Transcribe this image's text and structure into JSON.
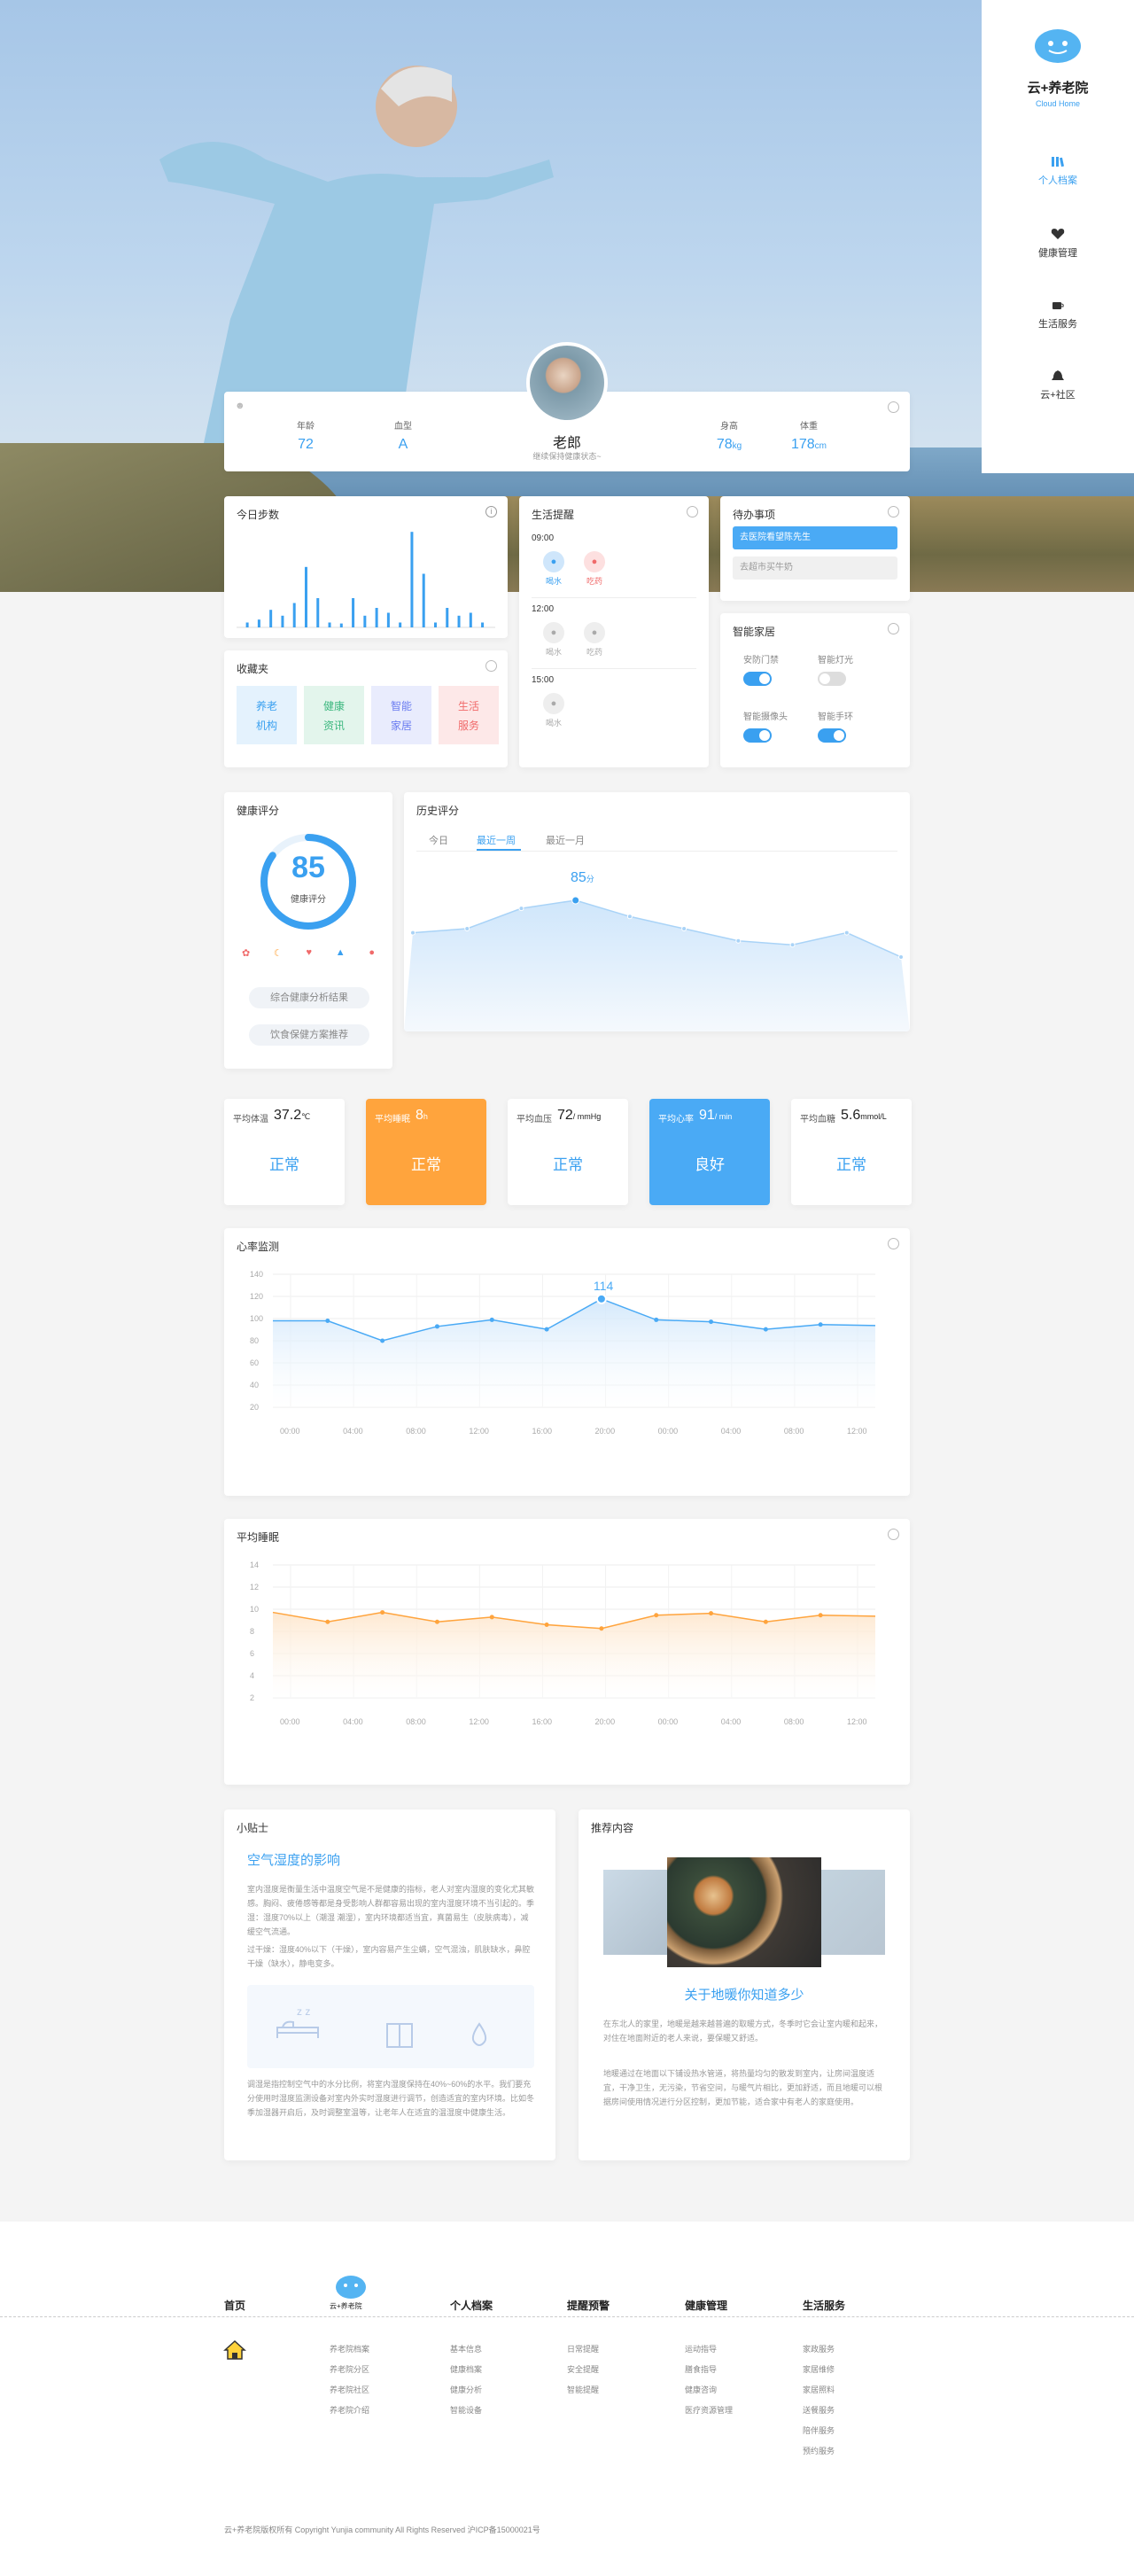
{
  "brand": {
    "name": "云+养老院",
    "sub": "Cloud Home"
  },
  "nav": [
    {
      "label": "个人档案",
      "active": true
    },
    {
      "label": "健康管理",
      "active": false
    },
    {
      "label": "生活服务",
      "active": false
    },
    {
      "label": "云+社区",
      "active": false
    }
  ],
  "profile": {
    "name": "老郎",
    "subtitle": "继续保持健康状态~",
    "fields": [
      {
        "label": "年龄",
        "value": "72",
        "unit": ""
      },
      {
        "label": "血型",
        "value": "A",
        "unit": ""
      },
      {
        "label": "身高",
        "value": "78",
        "unit": "kg"
      },
      {
        "label": "体重",
        "value": "178",
        "unit": "cm"
      }
    ]
  },
  "steps": {
    "title": "今日步数",
    "bars": [
      0.05,
      0.08,
      0.18,
      0.12,
      0.25,
      0.62,
      0.3,
      0.05,
      0.04,
      0.3,
      0.12,
      0.2,
      0.15,
      0.05,
      0.98,
      0.55,
      0.05,
      0.2,
      0.12,
      0.15,
      0.05
    ]
  },
  "favorites": {
    "title": "收藏夹",
    "tiles": [
      {
        "line1": "养老",
        "line2": "机构",
        "color": "#3aa0f0",
        "bg": "#e4f2fd"
      },
      {
        "line1": "健康",
        "line2": "资讯",
        "color": "#3bb77e",
        "bg": "#e3f5ec"
      },
      {
        "line1": "智能",
        "line2": "家居",
        "color": "#6a7cf0",
        "bg": "#e9ecfd"
      },
      {
        "line1": "生活",
        "line2": "服务",
        "color": "#f06a6a",
        "bg": "#fde8e8"
      }
    ]
  },
  "reminder": {
    "title": "生活提醒",
    "slots": [
      {
        "time": "09:00",
        "items": [
          {
            "label": "喝水",
            "state": "blue"
          },
          {
            "label": "吃药",
            "state": "red"
          }
        ]
      },
      {
        "time": "12:00",
        "items": [
          {
            "label": "喝水",
            "state": "grey"
          },
          {
            "label": "吃药",
            "state": "grey"
          }
        ]
      },
      {
        "time": "15:00",
        "items": [
          {
            "label": "喝水",
            "state": "grey"
          }
        ]
      }
    ]
  },
  "todo": {
    "title": "待办事项",
    "items": [
      "去医院看望陈先生",
      "去超市买牛奶"
    ]
  },
  "smart": {
    "title": "智能家居",
    "switches": [
      {
        "label": "安防门禁",
        "on": true
      },
      {
        "label": "智能灯光",
        "on": false
      },
      {
        "label": "智能摄像头",
        "on": true
      },
      {
        "label": "智能手环",
        "on": true
      }
    ]
  },
  "score": {
    "title": "健康评分",
    "value": "85",
    "label": "健康评分",
    "progress": 0.85,
    "links": [
      "综合健康分析结果",
      "饮食保健方案推荐"
    ]
  },
  "history": {
    "title": "历史评分",
    "tabs": [
      "今日",
      "最近一周",
      "最近一月"
    ],
    "active_tab": 1,
    "peak": "85",
    "peak_unit": "分",
    "values": [
      80,
      81,
      86,
      88,
      84,
      81,
      78,
      77,
      80,
      74
    ]
  },
  "stats": [
    {
      "name": "平均体温",
      "value": "37.2",
      "unit": "℃",
      "status": "正常",
      "style": "white"
    },
    {
      "name": "平均睡眠",
      "value": "8",
      "unit": "h",
      "status": "正常",
      "style": "orange"
    },
    {
      "name": "平均血压",
      "value": "72",
      "unit": "/ mmHg",
      "status": "正常",
      "style": "white"
    },
    {
      "name": "平均心率",
      "value": "91",
      "unit": "/ min",
      "status": "良好",
      "style": "blue"
    },
    {
      "name": "平均血糖",
      "value": "5.6",
      "unit": "mmol/L",
      "status": "正常",
      "style": "white"
    }
  ],
  "chart_data": [
    {
      "type": "area",
      "title": "心率监测",
      "x": [
        "00:00",
        "04:00",
        "08:00",
        "12:00",
        "16:00",
        "20:00",
        "00:00",
        "04:00",
        "08:00",
        "12:00"
      ],
      "y_ticks": [
        "140",
        "120",
        "100",
        "80",
        "60",
        "40",
        "20"
      ],
      "ylim": [
        0,
        140
      ],
      "series": [
        {
          "values": [
            91,
            91,
            70,
            85,
            92,
            82,
            114,
            92,
            90,
            82,
            87,
            86
          ]
        }
      ],
      "annotation": "114"
    },
    {
      "type": "area",
      "title": "平均睡眠",
      "x": [
        "00:00",
        "04:00",
        "08:00",
        "12:00",
        "16:00",
        "20:00",
        "00:00",
        "04:00",
        "08:00",
        "12:00"
      ],
      "y_ticks": [
        "14",
        "12",
        "10",
        "8",
        "6",
        "4",
        "2"
      ],
      "ylim": [
        0,
        14
      ],
      "series": [
        {
          "values": [
            9,
            8,
            9,
            8,
            8.5,
            7.7,
            7.3,
            8.7,
            8.9,
            8,
            8.7,
            8.6
          ]
        }
      ]
    }
  ],
  "tips": {
    "title": "小贴士",
    "heading": "空气湿度的影响",
    "p1": "室内湿度是衡量生活中温度空气是不是健康的指标，老人对室内湿度的变化尤其敏感。胸闷、疲倦感等都是身受影响人群都容易出现的室内湿度环境不当引起的。季湿：湿度70%以上（潮湿 潮湿），室内环境都适当宜，真菌易生（皮肤病毒），减缓空气流通。",
    "p2": "过干燥：湿度40%以下（干燥），室内容易产生尘螨，空气混浊，肌肤缺水，鼻腔干燥（缺水），静电变多。",
    "p3": "调湿是指控制空气中的水分比例，将室内湿度保持在40%~60%的水平。我们要充分使用时湿度监测设备对室内外实时湿度进行调节，创造适宜的室内环境。比如冬季加湿器开启后，及时调整室温等，让老年人在适宜的温湿度中健康生活。"
  },
  "recommend": {
    "title": "推荐内容",
    "heading": "关于地暖你知道多少",
    "p1": "在东北人的家里，地暖是越来越普遍的取暖方式，冬季时它会让室内暖和起来，对住在地面附近的老人来说，要保暖又舒适。",
    "p2": "地暖通过在地面以下铺设热水管道，将热量均匀的散发到室内，让房间温度适宜，干净卫生，无污染，节省空间，与暖气片相比，更加舒适，而且地暖可以根据房间使用情况进行分区控制，更加节能，适合家中有老人的家庭使用。"
  },
  "footer": {
    "cols": [
      {
        "title": "首页",
        "items": []
      },
      {
        "title": "",
        "items": [
          "养老院档案",
          "养老院分区",
          "养老院社区",
          "养老院介绍"
        ]
      },
      {
        "title": "个人档案",
        "items": [
          "基本信息",
          "健康档案",
          "健康分析",
          "智能设备"
        ]
      },
      {
        "title": "提醒预警",
        "items": [
          "日常提醒",
          "安全提醒",
          "智能提醒"
        ]
      },
      {
        "title": "健康管理",
        "items": [
          "运动指导",
          "膳食指导",
          "健康咨询",
          "医疗资源管理"
        ]
      },
      {
        "title": "生活服务",
        "items": [
          "家政服务",
          "家居维修",
          "家居照料",
          "送餐服务",
          "陪伴服务",
          "预约服务"
        ]
      }
    ],
    "copyright": "云+养老院版权所有   Copyright Yunjia community All Rights Reserved   沪ICP备15000021号"
  }
}
